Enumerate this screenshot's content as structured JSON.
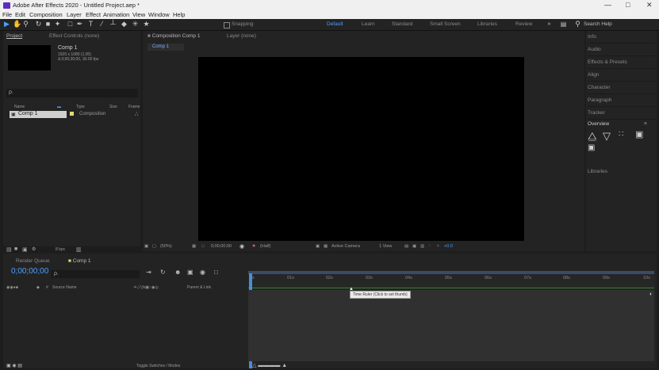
{
  "window": {
    "title": "Adobe After Effects 2020 - Untitled Project.aep *",
    "minimize": "—",
    "maximize": "□",
    "close": "✕"
  },
  "menu": [
    "File",
    "Edit",
    "Composition",
    "Layer",
    "Effect",
    "Animation",
    "View",
    "Window",
    "Help"
  ],
  "toolbar": {
    "snapping": "Snapping",
    "workspaces": [
      "Default",
      "Learn",
      "Standard",
      "Small Screen",
      "Libraries",
      "Review"
    ],
    "search_placeholder": "Search Help"
  },
  "project_panel": {
    "tab_project": "Project",
    "tab_effect_controls": "Effect Controls (none)",
    "comp_name": "Comp 1",
    "comp_size": "1920 x 1080 (1.00)",
    "comp_duration": "Δ 0;00;30;00, 30.00 fps",
    "search_placeholder": "ρ.",
    "col_name": "Name",
    "col_type": "Type",
    "col_size": "Size",
    "col_frame": "Frame",
    "item_name": "Comp 1",
    "item_type": "Composition",
    "bpc": "8 bpc"
  },
  "comp_panel": {
    "tab_comp": "Composition Comp 1",
    "tab_layer": "Layer (none)",
    "breadcrumb": "Comp 1",
    "zoom": "(50%)",
    "timecode": "0;00;00;00",
    "resolution": "(Half)",
    "camera": "Active Camera",
    "views": "1 View",
    "offset": "+0.0"
  },
  "right_panel": {
    "items": [
      "Info",
      "Audio",
      "Effects & Presets",
      "Align",
      "Character",
      "Paragraph",
      "Tracker"
    ],
    "overview_title": "Overview",
    "bottom_item": "Libraries"
  },
  "timeline": {
    "tab_render": "Render Queue",
    "tab_comp": "Comp 1",
    "timecode": "0;00;00;00",
    "search_placeholder": "ρ.",
    "col_source": "Source Name",
    "col_parent": "Parent & Link",
    "ticks": [
      "0s",
      "01s",
      "02s",
      "03s",
      "04s",
      "05s",
      "06s",
      "07s",
      "08s",
      "09s",
      "10s"
    ],
    "tooltip": "Time Ruler (Click to set thumb)",
    "footer": "Toggle Switches / Modes"
  }
}
